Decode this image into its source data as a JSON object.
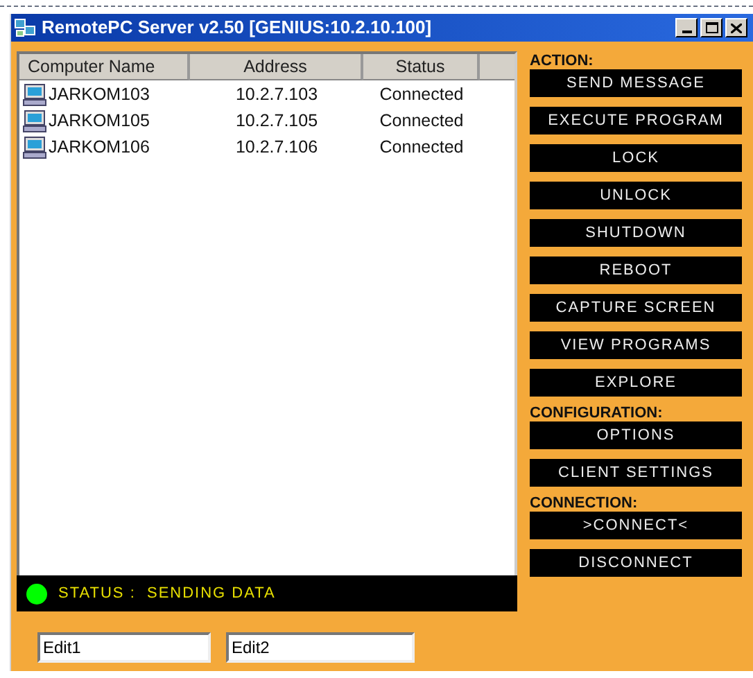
{
  "window": {
    "title": "RemotePC Server v2.50 [GENIUS:10.2.10.100]"
  },
  "table": {
    "columns": [
      "Computer Name",
      "Address",
      "Status"
    ],
    "rows": [
      {
        "name": "JARKOM103",
        "address": "10.2.7.103",
        "status": "Connected"
      },
      {
        "name": "JARKOM105",
        "address": "10.2.7.105",
        "status": "Connected"
      },
      {
        "name": "JARKOM106",
        "address": "10.2.7.106",
        "status": "Connected"
      }
    ]
  },
  "status_bar": {
    "text": "STATUS :  SENDING DATA",
    "color": "#00ff00"
  },
  "sections": [
    {
      "heading": "ACTION:",
      "buttons": [
        "SEND MESSAGE",
        "EXECUTE PROGRAM",
        "LOCK",
        "UNLOCK",
        "SHUTDOWN",
        "REBOOT",
        "CAPTURE SCREEN",
        "VIEW PROGRAMS",
        "EXPLORE"
      ]
    },
    {
      "heading": "CONFIGURATION:",
      "buttons": [
        "OPTIONS",
        "CLIENT SETTINGS"
      ]
    },
    {
      "heading": "CONNECTION:",
      "buttons": [
        ">CONNECT<",
        "DISCONNECT"
      ]
    }
  ],
  "fields": [
    {
      "value": "Edit1"
    },
    {
      "value": "Edit2"
    }
  ]
}
